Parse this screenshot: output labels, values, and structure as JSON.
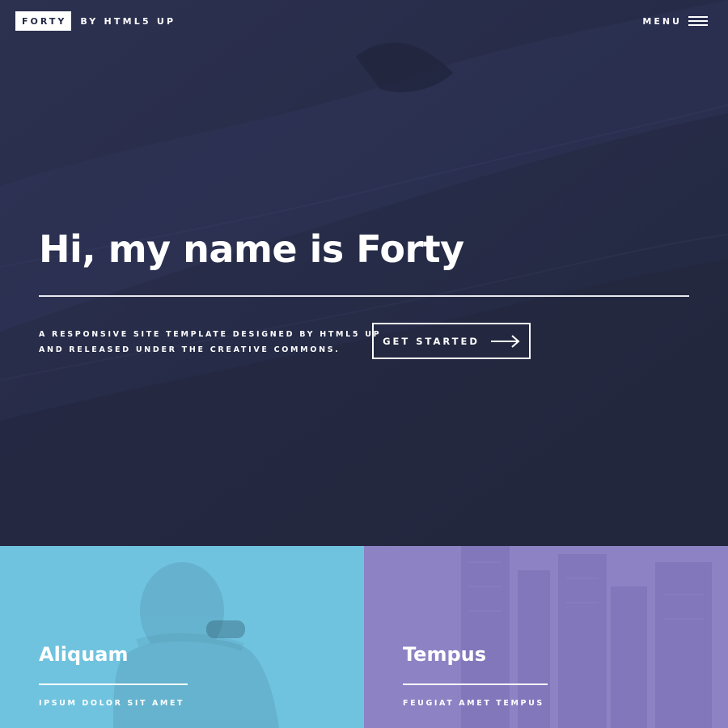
{
  "header": {
    "logo": "FORTY",
    "byline": "BY HTML5 UP",
    "menu_label": "MENU"
  },
  "hero": {
    "title": "Hi, my name is Forty",
    "description_lines": [
      "A RESPONSIVE SITE TEMPLATE DESIGNED BY HTML5 UP",
      "AND RELEASED UNDER THE CREATIVE COMMONS."
    ],
    "cta_label": "GET STARTED"
  },
  "tiles": [
    {
      "title": "Aliquam",
      "subtitle": "IPSUM DOLOR SIT AMET",
      "color": "#6fc3df"
    },
    {
      "title": "Tempus",
      "subtitle": "FEUGIAT AMET TEMPUS",
      "color": "#8d82c4"
    }
  ],
  "colors": {
    "background": "#242943",
    "hero_overlay": "#2a2f4b",
    "accent_blue": "#6fc3df",
    "accent_purple": "#8d82c4"
  },
  "icons": {
    "menu": "hamburger-icon",
    "cta": "arrow-right-icon"
  }
}
